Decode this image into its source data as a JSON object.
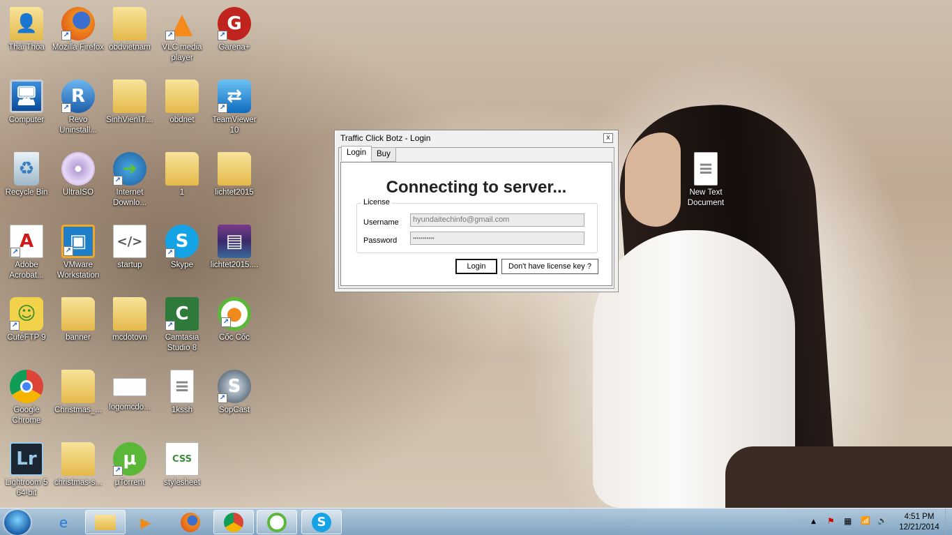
{
  "desktop_icons": [
    {
      "label": "Thái Thỏa",
      "icon": "user-folder-icon"
    },
    {
      "label": "Mozilla Firefox",
      "icon": "firefox-icon"
    },
    {
      "label": "obdvietnam",
      "icon": "folder-icon"
    },
    {
      "label": "VLC media player",
      "icon": "vlc-icon"
    },
    {
      "label": "Garena+",
      "icon": "garena-icon"
    },
    {
      "label": "Computer",
      "icon": "computer-icon"
    },
    {
      "label": "Revo Uninstall...",
      "icon": "revo-uninstaller-icon"
    },
    {
      "label": "SinhVienIT....",
      "icon": "folder-icon"
    },
    {
      "label": "obdnet",
      "icon": "folder-icon"
    },
    {
      "label": "TeamViewer 10",
      "icon": "teamviewer-icon"
    },
    {
      "label": "Recycle Bin",
      "icon": "recycle-bin-icon"
    },
    {
      "label": "UltraISO",
      "icon": "ultraiso-icon"
    },
    {
      "label": "Internet Downlo...",
      "icon": "idm-icon"
    },
    {
      "label": "1",
      "icon": "folder-icon"
    },
    {
      "label": "lichtet2015",
      "icon": "folder-icon"
    },
    {
      "label": "Adobe Acrobat...",
      "icon": "acrobat-icon"
    },
    {
      "label": "VMware Workstation",
      "icon": "vmware-icon"
    },
    {
      "label": "startup",
      "icon": "php-file-icon"
    },
    {
      "label": "Skype",
      "icon": "skype-icon"
    },
    {
      "label": "lichtet2015....",
      "icon": "winrar-icon"
    },
    {
      "label": "CuteFTP 9",
      "icon": "cuteftp-icon"
    },
    {
      "label": "banner",
      "icon": "folder-icon"
    },
    {
      "label": "mcdotovn",
      "icon": "folder-icon"
    },
    {
      "label": "Camtasia Studio 8",
      "icon": "camtasia-icon"
    },
    {
      "label": "Cốc Cốc",
      "icon": "coccoc-icon"
    },
    {
      "label": "Google Chrome",
      "icon": "chrome-icon"
    },
    {
      "label": "Christmas_...",
      "icon": "folder-icon"
    },
    {
      "label": "logomcdo...",
      "icon": "image-file-icon"
    },
    {
      "label": "1kssh",
      "icon": "text-file-icon"
    },
    {
      "label": "SopCast",
      "icon": "sopcast-icon"
    },
    {
      "label": "Lightroom 5 64-bit",
      "icon": "lightroom-icon"
    },
    {
      "label": "christmas-s...",
      "icon": "folder-icon"
    },
    {
      "label": "µTorrent",
      "icon": "utorrent-icon"
    },
    {
      "label": "stylesheet",
      "icon": "css-file-icon"
    },
    {
      "label": "New Text Document",
      "icon": "text-file-icon"
    }
  ],
  "dialog": {
    "title": "Traffic Click Botz - Login",
    "close_glyph": "x",
    "tabs": [
      "Login",
      "Buy"
    ],
    "heading": "Connecting to server...",
    "group_label": "License",
    "username_label": "Username",
    "username_value": "hyundaitechinfo@gmail.com",
    "password_label": "Password",
    "password_value": "•••••••••••",
    "login_button": "Login",
    "license_button": "Don't have license key ?"
  },
  "taskbar": {
    "pinned": [
      "ie-icon",
      "explorer-icon",
      "media-player-icon",
      "firefox-icon",
      "chrome-icon",
      "coccoc-icon",
      "skype-icon"
    ],
    "tray_glyphs": {
      "up_arrow": "▲",
      "flag": "⚑",
      "network": "📶",
      "volume": "🔊"
    },
    "time": "4:51 PM",
    "date": "12/21/2014"
  },
  "colors": {
    "taskbar": "#9cc0dc",
    "accent": "#1b5fbf"
  }
}
